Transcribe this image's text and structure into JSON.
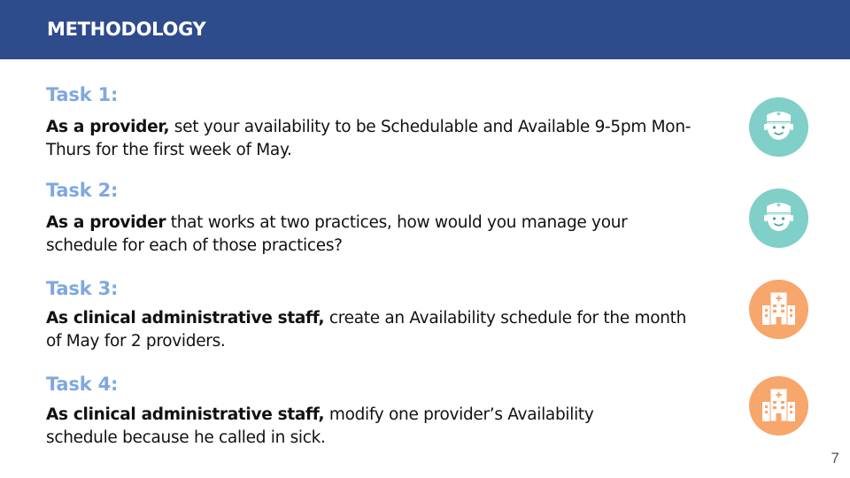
{
  "header": {
    "title": "METHODOLOGY"
  },
  "tasks": [
    {
      "heading": "Task 1:",
      "lead": "As a provider,",
      "text": " set your availability to be Schedulable and Available 9-5pm Mon-Thurs for the first week of May."
    },
    {
      "heading": "Task 2:",
      "lead": "As a provider",
      "text": " that works at two practices, how would you manage your schedule for each of those practices?"
    },
    {
      "heading": "Task 3:",
      "lead": "As clinical administrative staff,",
      "text": " create an Availability schedule for the month of May for 2 providers."
    },
    {
      "heading": "Task 4:",
      "lead": "As clinical administrative staff,",
      "text": " modify one provider’s Availability schedule because he called in sick."
    }
  ],
  "icons": [
    {
      "name": "doctor-icon",
      "color": "#80cfc8"
    },
    {
      "name": "doctor-icon",
      "color": "#80cfc8"
    },
    {
      "name": "hospital-icon",
      "color": "#f7a66c"
    },
    {
      "name": "hospital-icon",
      "color": "#f7a66c"
    }
  ],
  "footer": {
    "page_number": "7"
  },
  "colors": {
    "header_bg": "#2e4b8c",
    "task_heading": "#7fa8e0"
  }
}
